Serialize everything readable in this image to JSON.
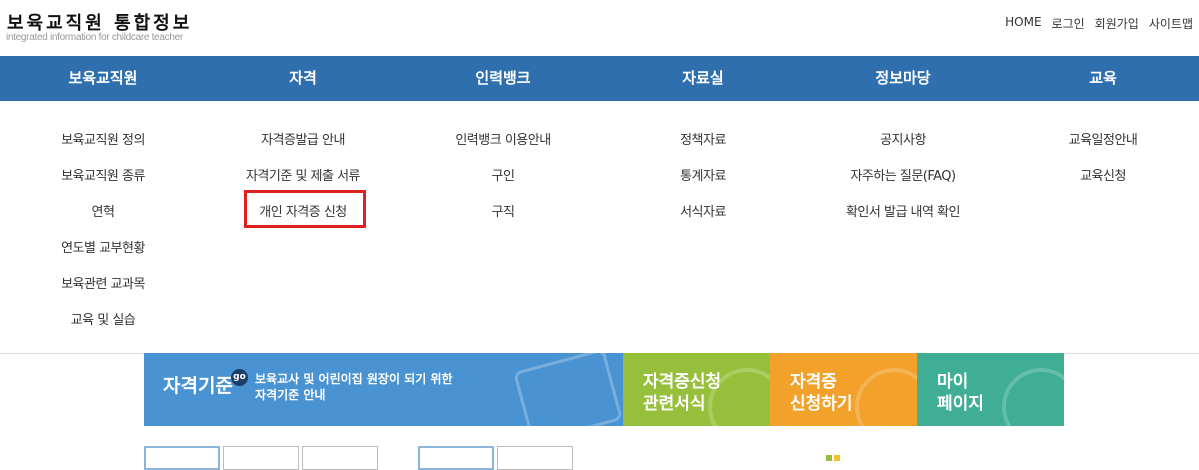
{
  "header": {
    "title": "보육교직원 통합정보",
    "subtitle": "integrated information for childcare teacher",
    "util_links": [
      "HOME",
      "로그인",
      "회원가입",
      "사이트맵"
    ]
  },
  "gnb": [
    {
      "label": "보육교직원",
      "items": [
        "보육교직원 정의",
        "보육교직원 종류",
        "연혁",
        "연도별 교부현황",
        "보육관련 교과목",
        "교육 및 실습"
      ]
    },
    {
      "label": "자격",
      "items": [
        "자격증발급 안내",
        "자격기준 및 제출 서류",
        "개인 자격증 신청"
      ]
    },
    {
      "label": "인력뱅크",
      "items": [
        "인력뱅크 이용안내",
        "구인",
        "구직"
      ]
    },
    {
      "label": "자료실",
      "items": [
        "정책자료",
        "통계자료",
        "서식자료"
      ]
    },
    {
      "label": "정보마당",
      "items": [
        "공지사항",
        "자주하는 질문(FAQ)",
        "확인서 발급 내역 확인"
      ]
    },
    {
      "label": "교육",
      "items": [
        "교육일정안내",
        "교육신청"
      ]
    }
  ],
  "banners": {
    "main_title": "자격기준",
    "go": "go",
    "main_desc_line1": "보육교사 및 어린이집 원장이 되기 위한",
    "main_desc_line2": "자격기준 안내",
    "green_line1": "자격증신청",
    "green_line2": "관련서식",
    "orange_line1": "자격증",
    "orange_line2": "신청하기",
    "teal_line1": "마이",
    "teal_line2": "페이지"
  },
  "colors": {
    "nav": "#2f6fad",
    "highlight": "#e0201f",
    "green": "#96c03b",
    "orange": "#f2a12a",
    "teal": "#3fae94",
    "blue": "#4a93d2"
  }
}
